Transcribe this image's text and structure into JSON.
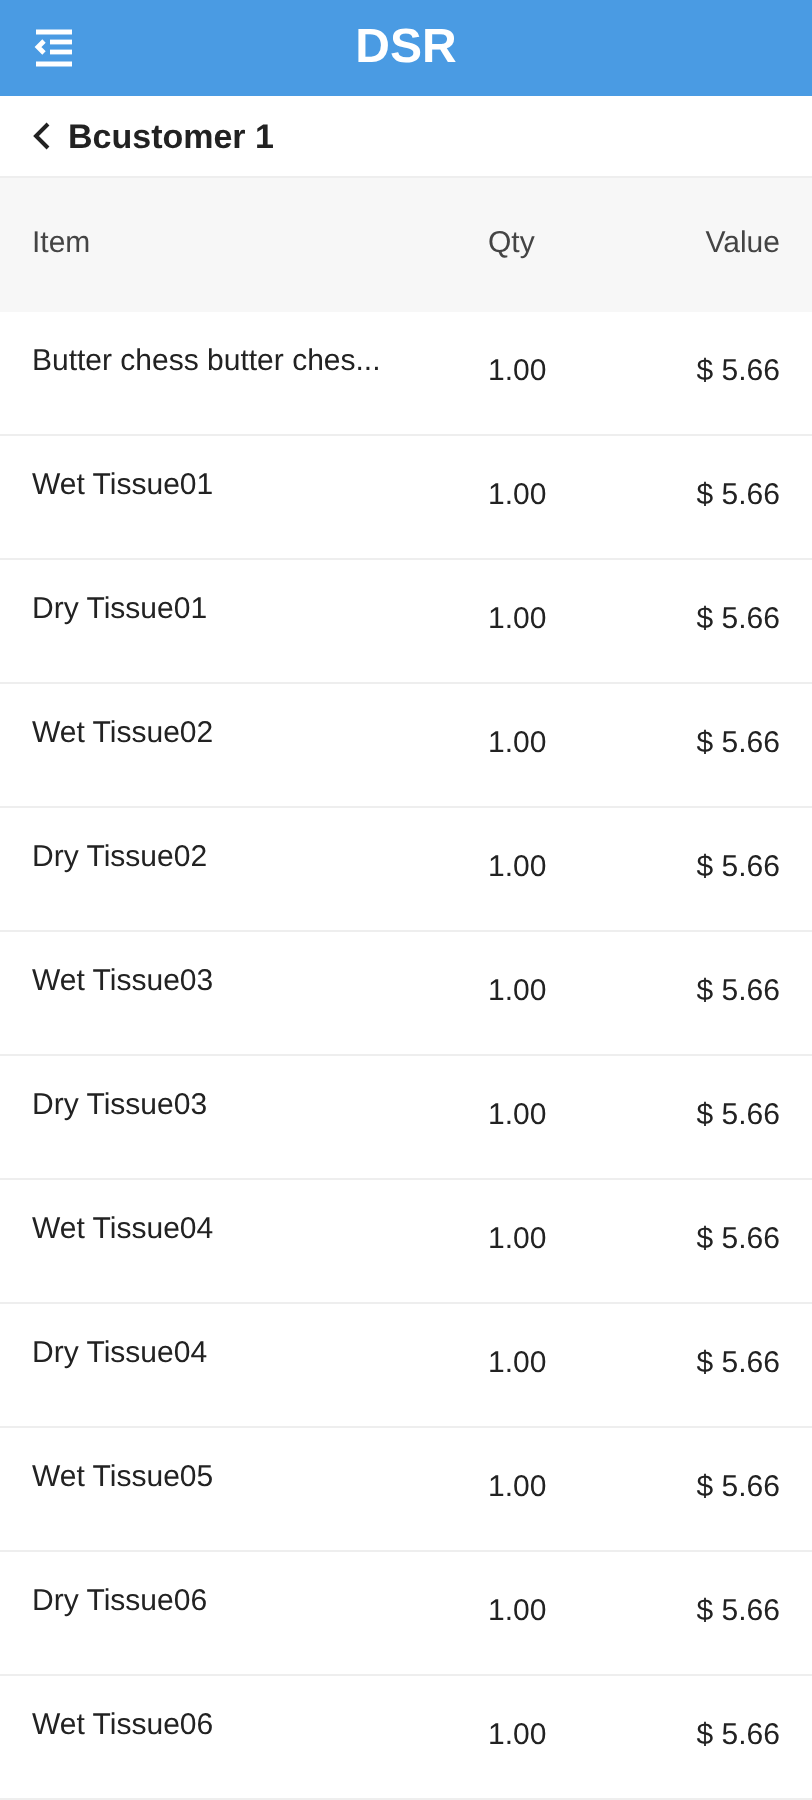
{
  "app_bar": {
    "title": "DSR"
  },
  "back_bar": {
    "label": "Bcustomer 1"
  },
  "table": {
    "columns": [
      "Item",
      "Qty",
      "Value"
    ],
    "rows": [
      [
        "Butter chess butter ches...",
        "1.00",
        "$ 5.66"
      ],
      [
        "Wet Tissue01",
        "1.00",
        "$ 5.66"
      ],
      [
        "Dry Tissue01",
        "1.00",
        "$ 5.66"
      ],
      [
        "Wet Tissue02",
        "1.00",
        "$ 5.66"
      ],
      [
        "Dry Tissue02",
        "1.00",
        "$ 5.66"
      ],
      [
        "Wet Tissue03",
        "1.00",
        "$ 5.66"
      ],
      [
        "Dry Tissue03",
        "1.00",
        "$ 5.66"
      ],
      [
        "Wet Tissue04",
        "1.00",
        "$ 5.66"
      ],
      [
        "Dry Tissue04",
        "1.00",
        "$ 5.66"
      ],
      [
        "Wet Tissue05",
        "1.00",
        "$ 5.66"
      ],
      [
        "Dry Tissue06",
        "1.00",
        "$ 5.66"
      ],
      [
        "Wet Tissue06",
        "1.00",
        "$ 5.66"
      ]
    ]
  }
}
